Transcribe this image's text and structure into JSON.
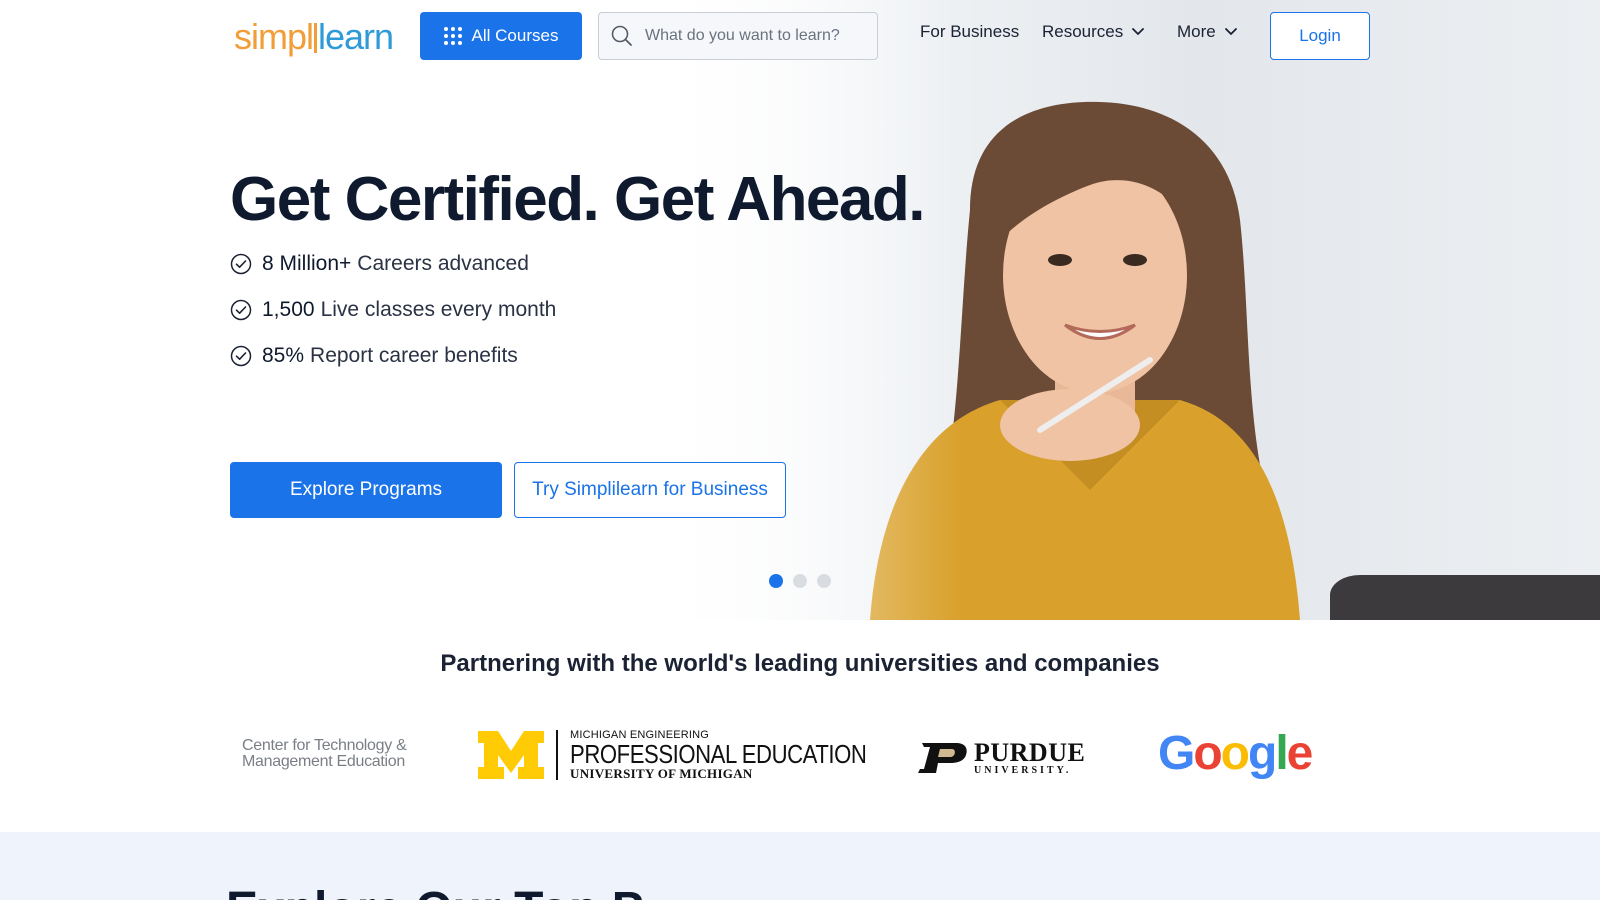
{
  "header": {
    "logo_text_1": "simpl",
    "logo_text_2": "learn",
    "all_courses_label": "All Courses",
    "search_placeholder": "What do you want to learn?",
    "nav": {
      "for_business": "For Business",
      "resources": "Resources",
      "more": "More"
    },
    "login_label": "Login"
  },
  "hero": {
    "title": "Get Certified. Get Ahead.",
    "stats": [
      {
        "value": "8 Million+",
        "label": "Careers advanced"
      },
      {
        "value": "1,500",
        "label": "Live classes every month"
      },
      {
        "value": "85%",
        "label": "Report career benefits"
      }
    ],
    "primary_cta": "Explore Programs",
    "secondary_cta": "Try Simplilearn for Business",
    "carousel": {
      "slide_count": 3,
      "active_slide": 1
    }
  },
  "partners": {
    "title": "Partnering with the world's leading universities and companies",
    "logos": {
      "ctme_line1": "Center for Technology &",
      "ctme_line2": "Management Education",
      "um_small": "MICHIGAN ENGINEERING",
      "um_big": "PROFESSIONAL EDUCATION",
      "um_sub": "UNIVERSITY OF MICHIGAN",
      "purdue_big": "PURDUE",
      "purdue_small": "UNIVERSITY.",
      "google": "Google"
    }
  },
  "next_section": {
    "title_partial": "Explore Our Top P"
  },
  "colors": {
    "primary": "#1a73e8",
    "logo_orange": "#f29d38",
    "logo_blue": "#2e9ad8",
    "section_bg": "#eff4fc"
  }
}
